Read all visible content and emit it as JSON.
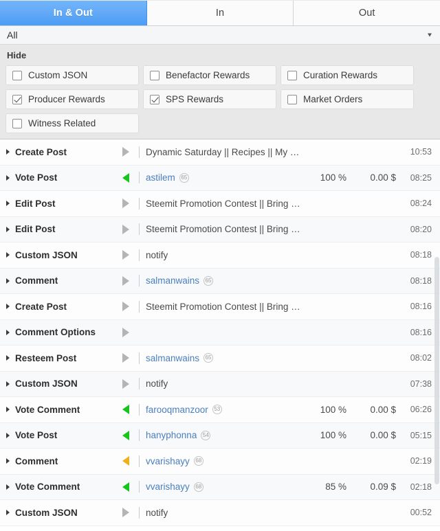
{
  "tabs": [
    {
      "label": "In & Out",
      "active": true
    },
    {
      "label": "In",
      "active": false
    },
    {
      "label": "Out",
      "active": false
    }
  ],
  "filter_select": {
    "value": "All",
    "caret_icon": "chevron-down-icon"
  },
  "hide_section": {
    "label": "Hide",
    "options": [
      {
        "label": "Custom JSON",
        "checked": false
      },
      {
        "label": "Benefactor Rewards",
        "checked": false
      },
      {
        "label": "Curation Rewards",
        "checked": false
      },
      {
        "label": "Producer Rewards",
        "checked": true
      },
      {
        "label": "SPS Rewards",
        "checked": true
      },
      {
        "label": "Market Orders",
        "checked": false
      },
      {
        "label": "Witness Related",
        "checked": false
      }
    ]
  },
  "colors": {
    "active_tab": "#4a9cf5",
    "incoming_green": "#18c51e",
    "incoming_orange": "#f0b019",
    "outgoing_gray": "#b4b4b4",
    "username_link": "#4a7fbd"
  },
  "transactions": [
    {
      "op": "Create Post",
      "direction": "out",
      "title": "Dynamic Saturday || Recipes || My Favori...",
      "user": "",
      "rep": "",
      "pct": "",
      "amt": "",
      "time": "10:53"
    },
    {
      "op": "Vote Post",
      "direction": "in-green",
      "title": "",
      "user": "astilem",
      "rep": "65",
      "pct": "100 %",
      "amt": "0.00 $",
      "time": "08:25"
    },
    {
      "op": "Edit Post",
      "direction": "out",
      "title": "Steemit Promotion Contest || Bring your ...",
      "user": "",
      "rep": "",
      "pct": "",
      "amt": "",
      "time": "08:24"
    },
    {
      "op": "Edit Post",
      "direction": "out",
      "title": "Steemit Promotion Contest || Bring your ...",
      "user": "",
      "rep": "",
      "pct": "",
      "amt": "",
      "time": "08:20"
    },
    {
      "op": "Custom JSON",
      "direction": "out",
      "title": "notify",
      "user": "",
      "rep": "",
      "pct": "",
      "amt": "",
      "time": "08:18"
    },
    {
      "op": "Comment",
      "direction": "out",
      "title": "",
      "user": "salmanwains",
      "rep": "65",
      "pct": "",
      "amt": "",
      "time": "08:18"
    },
    {
      "op": "Create Post",
      "direction": "out",
      "title": "Steemit Promotion Contest || Bring your ...",
      "user": "",
      "rep": "",
      "pct": "",
      "amt": "",
      "time": "08:16"
    },
    {
      "op": "Comment Options",
      "direction": "out",
      "title": "",
      "user": "",
      "rep": "",
      "pct": "",
      "amt": "",
      "time": "08:16",
      "no_divider": true
    },
    {
      "op": "Resteem Post",
      "direction": "out",
      "title": "",
      "user": "salmanwains",
      "rep": "65",
      "pct": "",
      "amt": "",
      "time": "08:02"
    },
    {
      "op": "Custom JSON",
      "direction": "out",
      "title": "notify",
      "user": "",
      "rep": "",
      "pct": "",
      "amt": "",
      "time": "07:38"
    },
    {
      "op": "Vote Comment",
      "direction": "in-green",
      "title": "",
      "user": "farooqmanzoor",
      "rep": "53",
      "pct": "100 %",
      "amt": "0.00 $",
      "time": "06:26"
    },
    {
      "op": "Vote Post",
      "direction": "in-green",
      "title": "",
      "user": "hanyphonna",
      "rep": "54",
      "pct": "100 %",
      "amt": "0.00 $",
      "time": "05:15"
    },
    {
      "op": "Comment",
      "direction": "in-orange",
      "title": "",
      "user": "vvarishayy",
      "rep": "68",
      "pct": "",
      "amt": "",
      "time": "02:19"
    },
    {
      "op": "Vote Comment",
      "direction": "in-green",
      "title": "",
      "user": "vvarishayy",
      "rep": "68",
      "pct": "85 %",
      "amt": "0.09 $",
      "time": "02:18"
    },
    {
      "op": "Custom JSON",
      "direction": "out",
      "title": "notify",
      "user": "",
      "rep": "",
      "pct": "",
      "amt": "",
      "time": "00:52"
    }
  ],
  "scrollbar": {
    "thumb_top_pct": 30,
    "thumb_height_pct": 58
  }
}
